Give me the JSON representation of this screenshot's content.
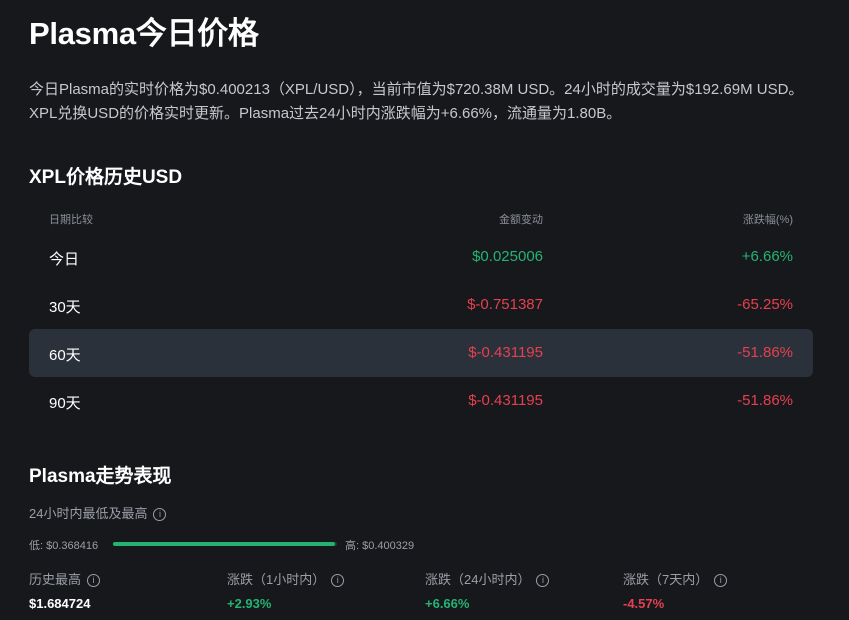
{
  "page": {
    "title": "Plasma今日价格",
    "description": "今日Plasma的实时价格为$0.400213（XPL/USD），当前市值为$720.38M USD。24小时的成交量为$192.69M USD。XPL兑换USD的价格实时更新。Plasma过去24小时内涨跌幅为+6.66%，流通量为1.80B。"
  },
  "history": {
    "heading": "XPL价格历史USD",
    "columns": [
      "日期比较",
      "金额变动",
      "涨跌幅(%)"
    ],
    "rows": [
      {
        "period": "今日",
        "change": "$0.025006",
        "pct": "+6.66%",
        "trend": "up"
      },
      {
        "period": "30天",
        "change": "$-0.751387",
        "pct": "-65.25%",
        "trend": "down"
      },
      {
        "period": "60天",
        "change": "$-0.431195",
        "pct": "-51.86%",
        "trend": "down",
        "highlighted": true
      },
      {
        "period": "90天",
        "change": "$-0.431195",
        "pct": "-51.86%",
        "trend": "down"
      }
    ]
  },
  "performance": {
    "heading": "Plasma走势表现",
    "range_label": "24小时内最低及最高",
    "low": "低: $0.368416",
    "high": "高: $0.400329",
    "range_position": 0.99,
    "stats": [
      {
        "label": "历史最高",
        "value": "$1.684724",
        "trend": "neutral"
      },
      {
        "label": "涨跌（1小时内）",
        "value": "+2.93%",
        "trend": "up"
      },
      {
        "label": "涨跌（24小时内）",
        "value": "+6.66%",
        "trend": "up"
      },
      {
        "label": "涨跌（7天内）",
        "value": "-4.57%",
        "trend": "down"
      }
    ]
  },
  "colors": {
    "up": "#25b372",
    "down": "#e5404f",
    "background": "#17181c",
    "highlight_row": "#2b313a"
  },
  "icons": {
    "info": "info-circle-icon"
  }
}
